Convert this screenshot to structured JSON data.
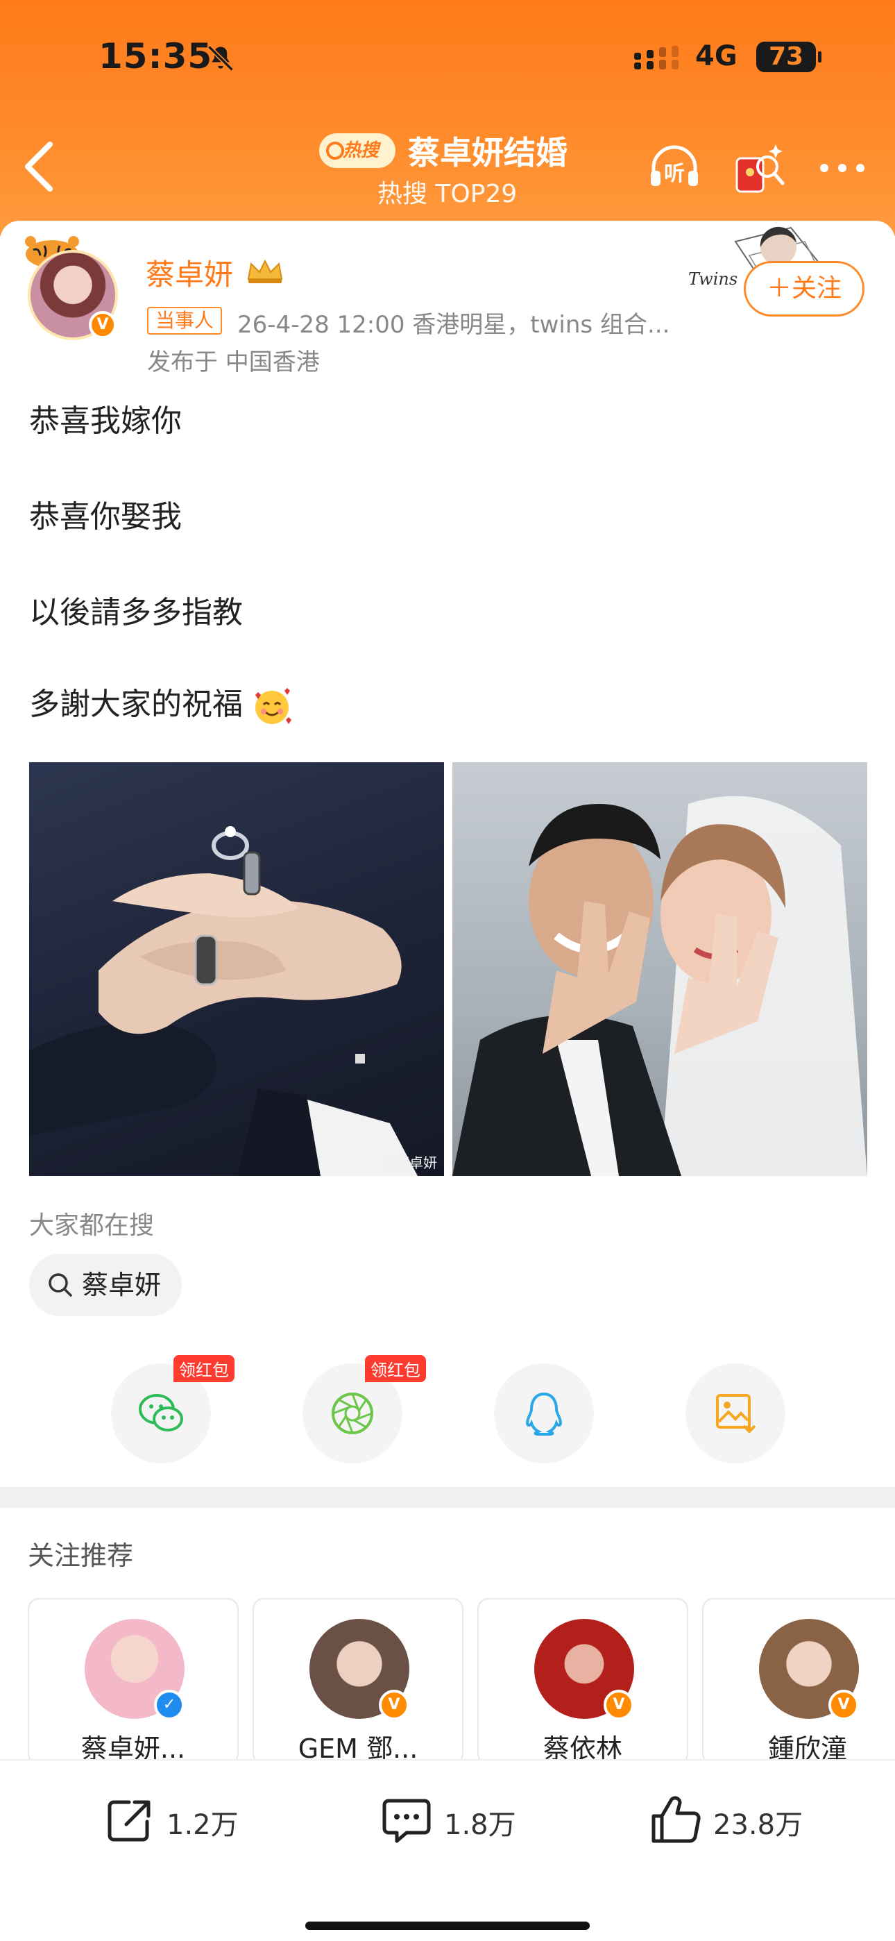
{
  "status_bar": {
    "time": "15:35",
    "network": "4G",
    "battery": "73"
  },
  "nav": {
    "hot_badge": "热搜",
    "title": "蔡卓妍结婚",
    "subtitle": "热搜 TOP29"
  },
  "post": {
    "author": "蔡卓妍",
    "role_tag": "当事人",
    "meta": "26-4-28 12:00  香港明星，twins 组合...",
    "location": "发布于 中国香港",
    "follow": "＋关注",
    "deco_word": "Twins",
    "lines": [
      "恭喜我嫁你",
      "恭喜你娶我",
      "以後請多多指教",
      "多謝大家的祝福"
    ],
    "photo_watermark": "@蔡卓妍"
  },
  "search": {
    "title": "大家都在搜",
    "chip": "蔡卓妍"
  },
  "share": {
    "redpack": "领红包"
  },
  "recommend": {
    "title": "关注推荐",
    "cards": [
      {
        "name": "蔡卓妍...",
        "v_color": "#1f8cf0"
      },
      {
        "name": "GEM 鄧...",
        "v_color": "#ff8a00"
      },
      {
        "name": "蔡依林",
        "v_color": "#ff8a00"
      },
      {
        "name": "鍾欣潼",
        "v_color": "#ff8a00"
      }
    ]
  },
  "actions": {
    "repost": "1.2万",
    "comment": "1.8万",
    "like": "23.8万"
  },
  "colors": {
    "accent": "#ff7a1a",
    "header_top": "#ff7a1a",
    "red_badge": "#ff3b30"
  }
}
